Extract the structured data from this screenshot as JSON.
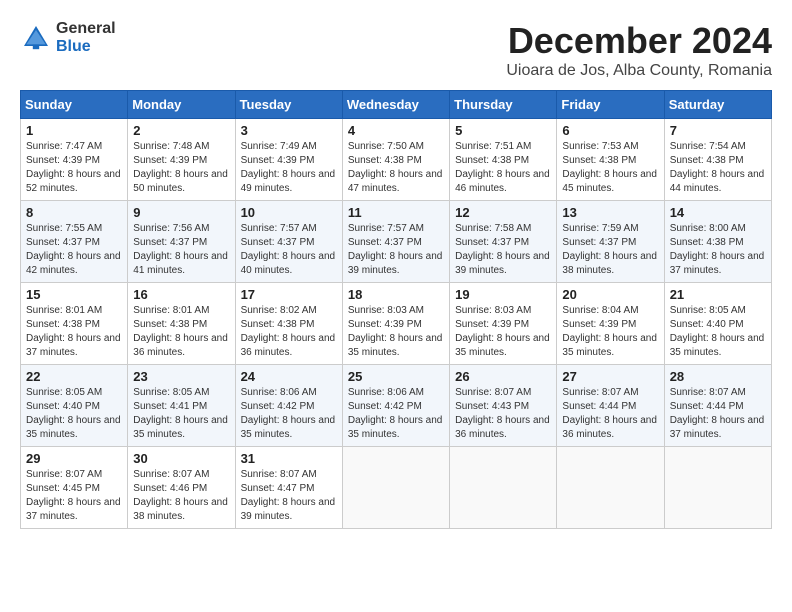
{
  "logo": {
    "general": "General",
    "blue": "Blue"
  },
  "title": {
    "month_year": "December 2024",
    "location": "Uioara de Jos, Alba County, Romania"
  },
  "weekdays": [
    "Sunday",
    "Monday",
    "Tuesday",
    "Wednesday",
    "Thursday",
    "Friday",
    "Saturday"
  ],
  "weeks": [
    [
      {
        "day": 1,
        "sunrise": "7:47 AM",
        "sunset": "4:39 PM",
        "daylight": "8 hours and 52 minutes."
      },
      {
        "day": 2,
        "sunrise": "7:48 AM",
        "sunset": "4:39 PM",
        "daylight": "8 hours and 50 minutes."
      },
      {
        "day": 3,
        "sunrise": "7:49 AM",
        "sunset": "4:39 PM",
        "daylight": "8 hours and 49 minutes."
      },
      {
        "day": 4,
        "sunrise": "7:50 AM",
        "sunset": "4:38 PM",
        "daylight": "8 hours and 47 minutes."
      },
      {
        "day": 5,
        "sunrise": "7:51 AM",
        "sunset": "4:38 PM",
        "daylight": "8 hours and 46 minutes."
      },
      {
        "day": 6,
        "sunrise": "7:53 AM",
        "sunset": "4:38 PM",
        "daylight": "8 hours and 45 minutes."
      },
      {
        "day": 7,
        "sunrise": "7:54 AM",
        "sunset": "4:38 PM",
        "daylight": "8 hours and 44 minutes."
      }
    ],
    [
      {
        "day": 8,
        "sunrise": "7:55 AM",
        "sunset": "4:37 PM",
        "daylight": "8 hours and 42 minutes."
      },
      {
        "day": 9,
        "sunrise": "7:56 AM",
        "sunset": "4:37 PM",
        "daylight": "8 hours and 41 minutes."
      },
      {
        "day": 10,
        "sunrise": "7:57 AM",
        "sunset": "4:37 PM",
        "daylight": "8 hours and 40 minutes."
      },
      {
        "day": 11,
        "sunrise": "7:57 AM",
        "sunset": "4:37 PM",
        "daylight": "8 hours and 39 minutes."
      },
      {
        "day": 12,
        "sunrise": "7:58 AM",
        "sunset": "4:37 PM",
        "daylight": "8 hours and 39 minutes."
      },
      {
        "day": 13,
        "sunrise": "7:59 AM",
        "sunset": "4:37 PM",
        "daylight": "8 hours and 38 minutes."
      },
      {
        "day": 14,
        "sunrise": "8:00 AM",
        "sunset": "4:38 PM",
        "daylight": "8 hours and 37 minutes."
      }
    ],
    [
      {
        "day": 15,
        "sunrise": "8:01 AM",
        "sunset": "4:38 PM",
        "daylight": "8 hours and 37 minutes."
      },
      {
        "day": 16,
        "sunrise": "8:01 AM",
        "sunset": "4:38 PM",
        "daylight": "8 hours and 36 minutes."
      },
      {
        "day": 17,
        "sunrise": "8:02 AM",
        "sunset": "4:38 PM",
        "daylight": "8 hours and 36 minutes."
      },
      {
        "day": 18,
        "sunrise": "8:03 AM",
        "sunset": "4:39 PM",
        "daylight": "8 hours and 35 minutes."
      },
      {
        "day": 19,
        "sunrise": "8:03 AM",
        "sunset": "4:39 PM",
        "daylight": "8 hours and 35 minutes."
      },
      {
        "day": 20,
        "sunrise": "8:04 AM",
        "sunset": "4:39 PM",
        "daylight": "8 hours and 35 minutes."
      },
      {
        "day": 21,
        "sunrise": "8:05 AM",
        "sunset": "4:40 PM",
        "daylight": "8 hours and 35 minutes."
      }
    ],
    [
      {
        "day": 22,
        "sunrise": "8:05 AM",
        "sunset": "4:40 PM",
        "daylight": "8 hours and 35 minutes."
      },
      {
        "day": 23,
        "sunrise": "8:05 AM",
        "sunset": "4:41 PM",
        "daylight": "8 hours and 35 minutes."
      },
      {
        "day": 24,
        "sunrise": "8:06 AM",
        "sunset": "4:42 PM",
        "daylight": "8 hours and 35 minutes."
      },
      {
        "day": 25,
        "sunrise": "8:06 AM",
        "sunset": "4:42 PM",
        "daylight": "8 hours and 35 minutes."
      },
      {
        "day": 26,
        "sunrise": "8:07 AM",
        "sunset": "4:43 PM",
        "daylight": "8 hours and 36 minutes."
      },
      {
        "day": 27,
        "sunrise": "8:07 AM",
        "sunset": "4:44 PM",
        "daylight": "8 hours and 36 minutes."
      },
      {
        "day": 28,
        "sunrise": "8:07 AM",
        "sunset": "4:44 PM",
        "daylight": "8 hours and 37 minutes."
      }
    ],
    [
      {
        "day": 29,
        "sunrise": "8:07 AM",
        "sunset": "4:45 PM",
        "daylight": "8 hours and 37 minutes."
      },
      {
        "day": 30,
        "sunrise": "8:07 AM",
        "sunset": "4:46 PM",
        "daylight": "8 hours and 38 minutes."
      },
      {
        "day": 31,
        "sunrise": "8:07 AM",
        "sunset": "4:47 PM",
        "daylight": "8 hours and 39 minutes."
      },
      null,
      null,
      null,
      null
    ]
  ]
}
